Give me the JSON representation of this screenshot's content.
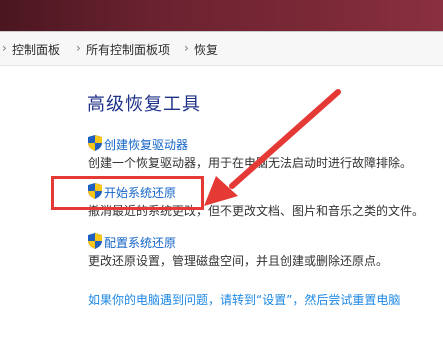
{
  "breadcrumb": {
    "items": [
      "控制面板",
      "所有控制面板项",
      "恢复"
    ],
    "separator": "›"
  },
  "main": {
    "heading": "高级恢复工具",
    "tasks": [
      {
        "link": "创建恢复驱动器",
        "description": "创建一个恢复驱动器，用于在电脑无法启动时进行故障排除。",
        "icon": "uac-shield-icon"
      },
      {
        "link": "开始系统还原",
        "description": "撤消最近的系统更改，但不更改文档、图片和音乐之类的文件。",
        "icon": "uac-shield-icon"
      },
      {
        "link": "配置系统还原",
        "description": "更改还原设置，管理磁盘空间，并且创建或删除还原点。",
        "icon": "uac-shield-icon"
      }
    ],
    "bottom_link": "如果你的电脑遇到问题，请转到“设置”，然后尝试重置电脑"
  },
  "annotation": {
    "color": "#e53935"
  },
  "colors": {
    "heading": "#1e3287",
    "link": "#1565c8",
    "bottom_link": "#1e88e5"
  }
}
